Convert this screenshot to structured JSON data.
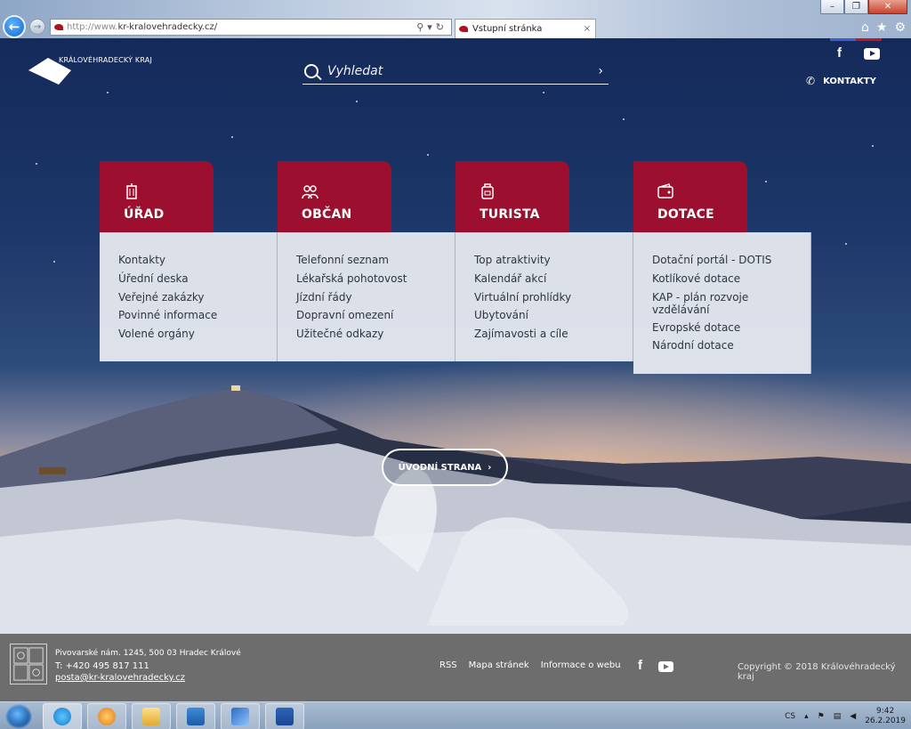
{
  "browser": {
    "address_prefix": "http://www.",
    "address_host": "kr-kralovehradecky.cz/",
    "tab_title": "Vstupní stránka",
    "tab_close": "×",
    "window_controls": [
      "–",
      "❐",
      "✕"
    ],
    "toolbar_icons": [
      "home-icon",
      "star-icon",
      "gear-icon"
    ]
  },
  "header": {
    "brand": "KRÁLOVÉHRADECKÝ KRAJ",
    "search_placeholder": "Vyhledat",
    "contacts_label": "KONTAKTY",
    "social": [
      "facebook",
      "youtube"
    ],
    "social_bar_colors": [
      "#3b5fd0",
      "#c4142a"
    ]
  },
  "menu": [
    {
      "title": "ÚŘAD",
      "icon": "building-icon",
      "items": [
        "Kontakty",
        "Úřední deska",
        "Veřejné zakázky",
        "Povinné informace",
        "Volené orgány"
      ]
    },
    {
      "title": "OBČAN",
      "icon": "people-icon",
      "items": [
        "Telefonní seznam",
        "Lékařská pohotovost",
        "Jízdní řády",
        "Dopravní omezení",
        "Užitečné odkazy"
      ]
    },
    {
      "title": "TURISTA",
      "icon": "backpack-icon",
      "items": [
        "Top atraktivity",
        "Kalendář akcí",
        "Virtuální prohlídky",
        "Ubytování",
        "Zajímavosti a cíle"
      ]
    },
    {
      "title": "DOTACE",
      "icon": "wallet-icon",
      "items": [
        "Dotační portál - DOTIS",
        "Kotlíkové dotace",
        "KAP - plán rozvoje vzdělávání",
        "Evropské dotace",
        "Národní dotace"
      ]
    }
  ],
  "cta": {
    "label": "ÚVODNÍ STRANA",
    "arrow": "›"
  },
  "footer": {
    "address": "Pivovarské nám. 1245, 500 03 Hradec Králové",
    "phone": "T: +420 495 817 111",
    "email": "posta@kr-kralovehradecky.cz",
    "links": [
      "RSS",
      "Mapa stránek",
      "Informace o webu"
    ],
    "copyright": "Copyright © 2018 Královéhradecký kraj"
  },
  "taskbar": {
    "apps": [
      "internet-explorer",
      "media-player",
      "file-explorer",
      "outlook",
      "pen-app",
      "word"
    ],
    "language": "CS",
    "time": "9:42",
    "date": "26.2.2019"
  },
  "colors": {
    "accent": "#9c0f2e",
    "card_bg": "#e4e7ee",
    "footer_bg": "#6d6d6d"
  }
}
